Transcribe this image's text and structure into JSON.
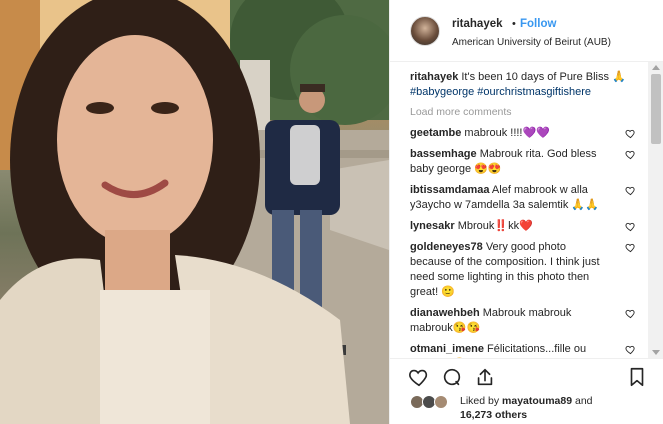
{
  "post": {
    "username": "ritahayek",
    "follow_label": "Follow",
    "dot": "•",
    "location": "American University of Beirut (AUB)"
  },
  "caption": {
    "username": "ritahayek",
    "text": " It's been 10 days of Pure Bliss 🙏",
    "hashtags": "#babygeorge #ourchristmasgiftishere"
  },
  "load_more": "Load more comments",
  "comments": [
    {
      "username": "geetambe",
      "text": " mabrouk !!!!💜💜"
    },
    {
      "username": "bassemhage",
      "text": " Mabrouk rita. God bless baby george 😍😍"
    },
    {
      "username": "ibtissamdamaa",
      "text": " Alef mabrook w alla y3aycho w 7amdella 3a salemtik 🙏🙏"
    },
    {
      "username": "lynesakr",
      "text": " Mbrouk‼️kk❤️"
    },
    {
      "username": "goldeneyes78",
      "text": " Very good photo because of the composition. I think just need some lighting in this photo then great! 🙂"
    },
    {
      "username": "dianawehbeh",
      "text": " Mabrouk mabrouk mabrouk😘😘"
    },
    {
      "username": "otmani_imene",
      "text": " Félicitations...fille ou garçon? 😊"
    }
  ],
  "likes": {
    "prefix": "Liked by ",
    "user": "mayatouma89",
    "mid": " and",
    "count": "16,273 others"
  },
  "icons": [
    "heart-icon",
    "comment-icon",
    "share-icon",
    "bookmark-icon"
  ]
}
